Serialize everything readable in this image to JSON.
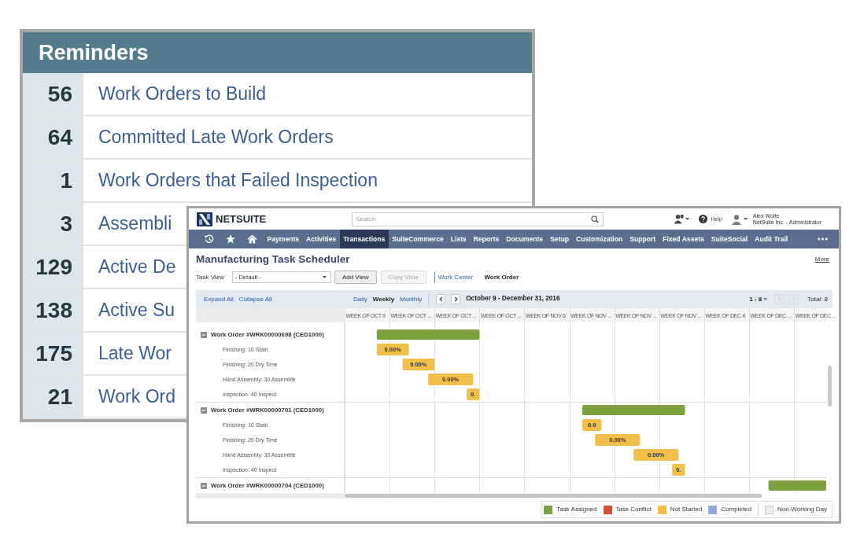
{
  "reminders": {
    "title": "Reminders",
    "items": [
      {
        "count": "56",
        "label": "Work Orders to Build"
      },
      {
        "count": "64",
        "label": "Committed Late Work Orders"
      },
      {
        "count": "1",
        "label": "Work Orders that Failed Inspection"
      },
      {
        "count": "3",
        "label": "Assembli"
      },
      {
        "count": "129",
        "label": "Active De"
      },
      {
        "count": "138",
        "label": "Active Su"
      },
      {
        "count": "175",
        "label": "Late Wor"
      },
      {
        "count": "21",
        "label": "Work Ord"
      }
    ]
  },
  "app": {
    "brand": "NETSUITE",
    "search": {
      "placeholder": "Search"
    },
    "help": "Help",
    "user": {
      "name": "Alex Wolfe",
      "account": "NetSuite Inc. - Administrator"
    },
    "nav": [
      {
        "label": "Payments",
        "selected": false
      },
      {
        "label": "Activities",
        "selected": false
      },
      {
        "label": "Transactions",
        "selected": true
      },
      {
        "label": "SuiteCommerce",
        "selected": false
      },
      {
        "label": "Lists",
        "selected": false
      },
      {
        "label": "Reports",
        "selected": false
      },
      {
        "label": "Documents",
        "selected": false
      },
      {
        "label": "Setup",
        "selected": false
      },
      {
        "label": "Customization",
        "selected": false
      },
      {
        "label": "Support",
        "selected": false
      },
      {
        "label": "Fixed Assets",
        "selected": false
      },
      {
        "label": "SuiteSocial",
        "selected": false
      },
      {
        "label": "Audit Trail",
        "selected": false
      }
    ],
    "page_title": "Manufacturing Task Scheduler",
    "more": "More",
    "task_view": {
      "label": "Task View",
      "value": "- Default -"
    },
    "buttons": [
      {
        "label": "Add View",
        "disabled": false
      },
      {
        "label": "Copy View",
        "disabled": true
      }
    ],
    "views": [
      {
        "label": "Work Center",
        "selected": false
      },
      {
        "label": "Work Order",
        "selected": true
      }
    ],
    "toolbar": {
      "expand": "Expand All",
      "collapse": "Collapse All",
      "scales": [
        {
          "label": "Daily",
          "selected": false
        },
        {
          "label": "Weekly",
          "selected": true
        },
        {
          "label": "Monthly",
          "selected": false
        }
      ],
      "date_nav": [
        {
          "kind": "prev",
          "disabled": false
        },
        {
          "kind": "next",
          "disabled": false
        }
      ],
      "date_range": "October 9 - December 31, 2016",
      "page_range": "1 - 8",
      "page_nav": [
        {
          "kind": "prev",
          "disabled": true
        },
        {
          "kind": "next",
          "disabled": true
        }
      ],
      "total": "Total: 8"
    },
    "schedule": {
      "weeks": [
        "WEEK OF OCT 9",
        "WEEK OF OCT ...",
        "WEEK OF OCT ...",
        "WEEK OF OCT ...",
        "WEEK OF NOV 6",
        "WEEK OF NOV ...",
        "WEEK OF NOV ...",
        "WEEK OF NOV ...",
        "WEEK OF DEC 4",
        "WEEK OF DEC ...",
        "WEEK OF DEC ..."
      ],
      "work_orders": [
        {
          "label": "Work Order #WRK00000698 (CED1000)",
          "expanded": true,
          "tasks": [
            {
              "label": "Finishing: 10 Stain",
              "progress": "0.00%"
            },
            {
              "label": "Finishing: 20 Dry Time",
              "progress": "0.00%"
            },
            {
              "label": "Hand Assembly: 30 Assemble",
              "progress": "0.00%"
            },
            {
              "label": "Inspection: 40 Inspect",
              "progress": "0."
            }
          ]
        },
        {
          "label": "Work Order #WRK00000701 (CED1000)",
          "expanded": true,
          "tasks": [
            {
              "label": "Finishing: 10 Stain",
              "progress": "0.0"
            },
            {
              "label": "Finishing: 20 Dry Time",
              "progress": "0.00%"
            },
            {
              "label": "Hand Assembly: 30 Assemble",
              "progress": "0.00%"
            },
            {
              "label": "Inspection: 40 Inspect",
              "progress": "0."
            }
          ]
        },
        {
          "label": "Work Order #WRK00000704 (CED1000)",
          "expanded": true
        }
      ]
    },
    "legend": [
      {
        "kind": "swatch",
        "label": "Task Assigned",
        "color": "#7ca13d"
      },
      {
        "kind": "swatch",
        "label": "Task Conflict",
        "color": "#dc4c3a"
      },
      {
        "kind": "swatch",
        "label": "Not Started",
        "color": "#f0c04b"
      },
      {
        "kind": "swatch",
        "label": "Completed",
        "color": "#93a9de"
      },
      {
        "kind": "separate",
        "label": "Non-Working Day",
        "color": "#eeeeee"
      }
    ]
  }
}
